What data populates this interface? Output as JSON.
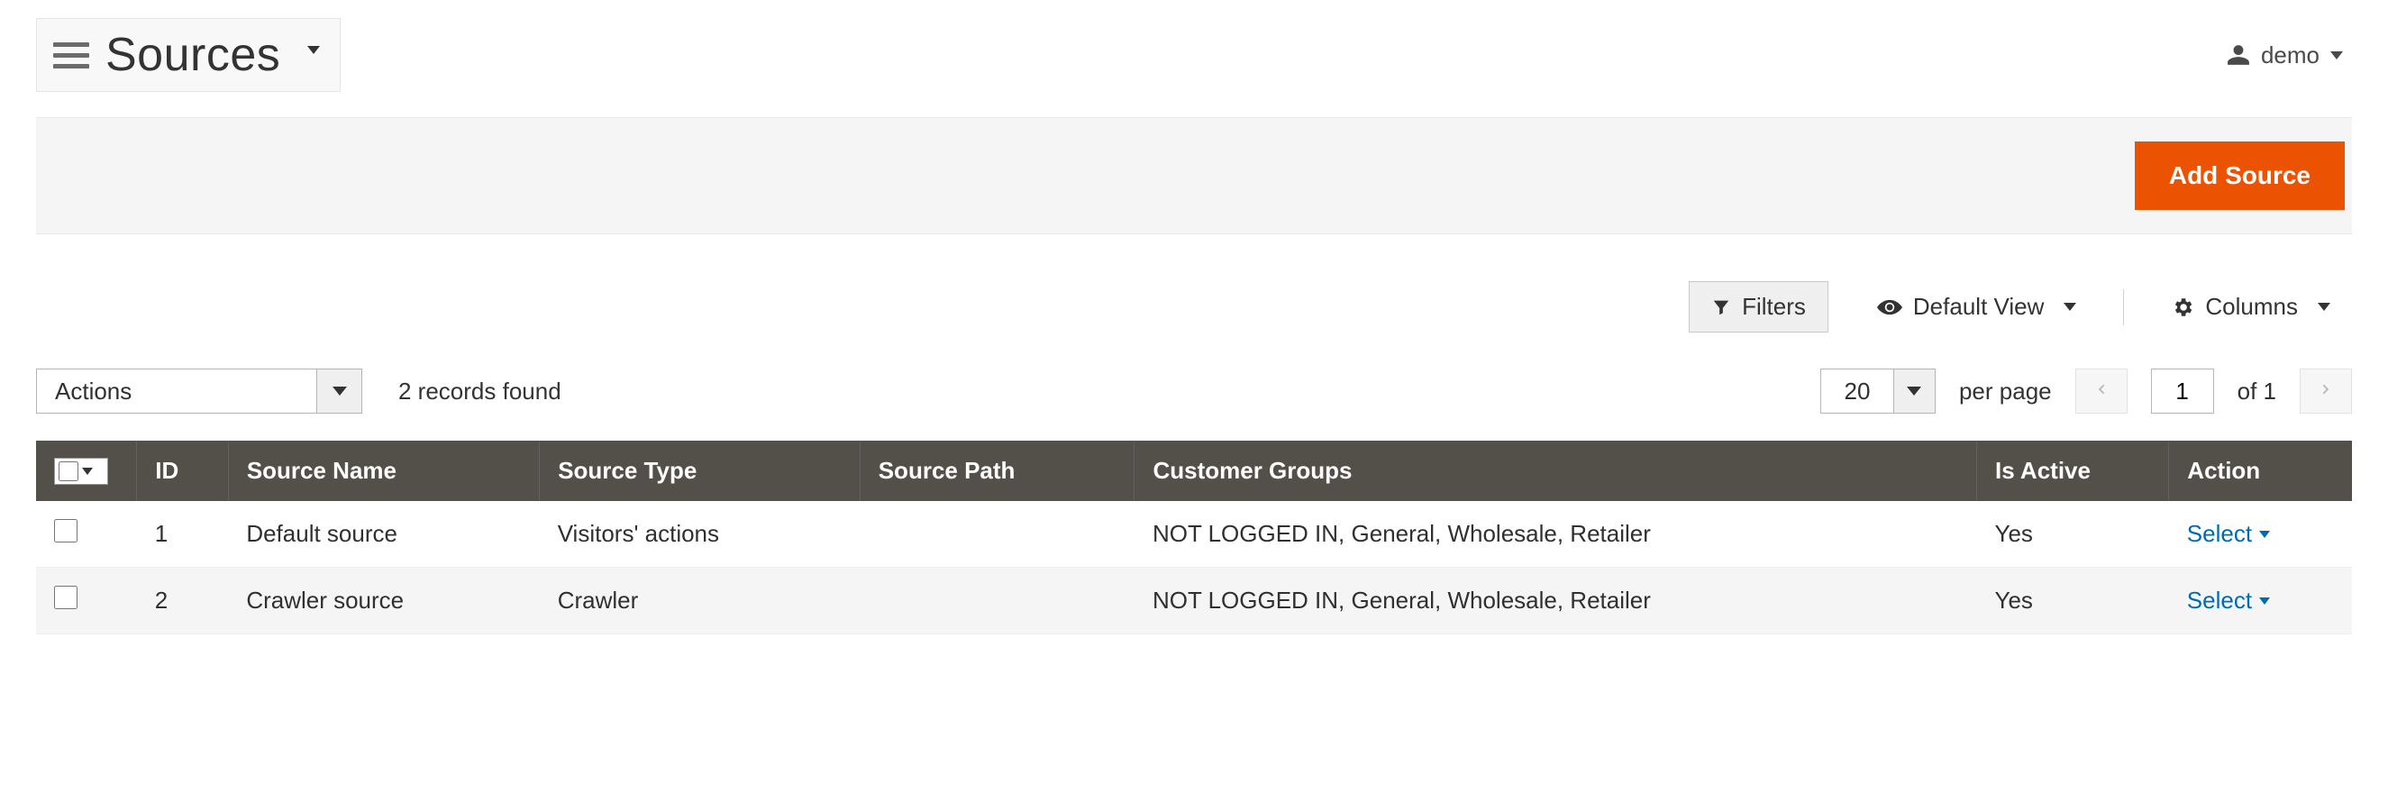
{
  "header": {
    "title": "Sources",
    "user": "demo"
  },
  "actions": {
    "add_source": "Add Source"
  },
  "grid_controls": {
    "filters": "Filters",
    "default_view": "Default View",
    "columns": "Columns",
    "actions_label": "Actions",
    "records_found": "2 records found",
    "page_size": "20",
    "per_page": "per page",
    "current_page": "1",
    "of_pages": "of 1"
  },
  "table": {
    "headers": {
      "id": "ID",
      "source_name": "Source Name",
      "source_type": "Source Type",
      "source_path": "Source Path",
      "customer_groups": "Customer Groups",
      "is_active": "Is Active",
      "action": "Action"
    },
    "rows": [
      {
        "id": "1",
        "source_name": "Default source",
        "source_type": "Visitors' actions",
        "source_path": "",
        "customer_groups": "NOT LOGGED IN, General, Wholesale, Retailer",
        "is_active": "Yes",
        "action": "Select"
      },
      {
        "id": "2",
        "source_name": "Crawler source",
        "source_type": "Crawler",
        "source_path": "",
        "customer_groups": "NOT LOGGED IN, General, Wholesale, Retailer",
        "is_active": "Yes",
        "action": "Select"
      }
    ]
  }
}
